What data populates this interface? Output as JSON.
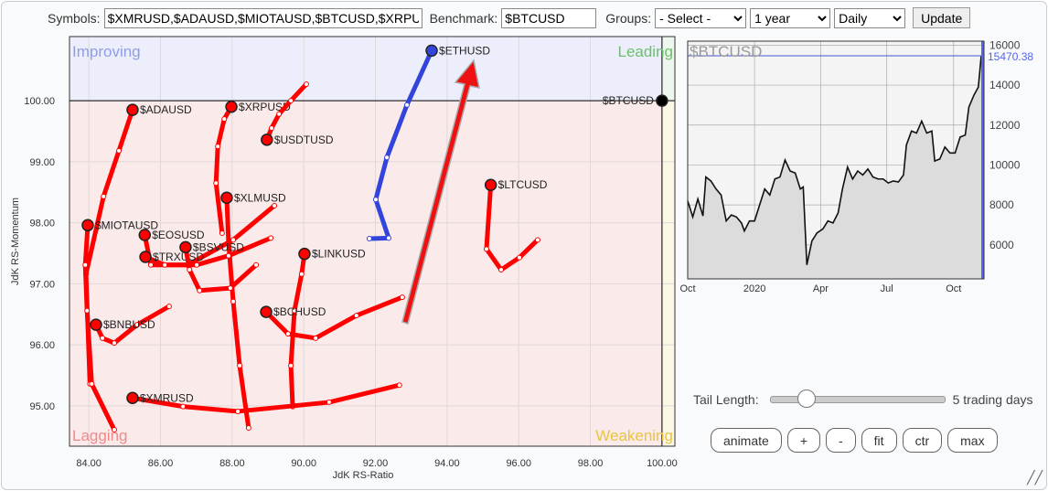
{
  "toolbar": {
    "symbols_label": "Symbols:",
    "symbols_value": "$XMRUSD,$ADAUSD,$MIOTAUSD,$BTCUSD,$XRPUSD",
    "benchmark_label": "Benchmark:",
    "benchmark_value": "$BTCUSD",
    "groups_label": "Groups:",
    "groups_value": "- Select -",
    "period_value": "1 year",
    "frequency_value": "Daily",
    "update_label": "Update"
  },
  "controls": {
    "tail_label": "Tail Length:",
    "tail_value_text": "5 trading days",
    "tail_fraction": 0.17,
    "buttons": [
      "animate",
      "+",
      "-",
      "fit",
      "ctr",
      "max"
    ]
  },
  "chart_data": [
    {
      "type": "scatter",
      "xlabel": "JdK RS-Ratio",
      "ylabel": "JdK RS-Momentum",
      "xlim": [
        83.46,
        100.36
      ],
      "ylim": [
        94.34,
        101.05
      ],
      "xticks": [
        "84.00",
        "86.00",
        "88.00",
        "90.00",
        "92.00",
        "94.00",
        "96.00",
        "98.00",
        "100.00"
      ],
      "yticks": [
        "95.00",
        "96.00",
        "97.00",
        "98.00",
        "99.00",
        "100.00"
      ],
      "grid": true,
      "quadrants": {
        "improving": "Improving",
        "leading": "Leading",
        "lagging": "Lagging",
        "weakening": "Weakening"
      },
      "colors": {
        "improving": "#8f9de8",
        "leading": "#6cbf6c",
        "lagging": "#f08a8a",
        "weakening": "#e8c440",
        "tail_red": "#ff0000",
        "tail_blue": "#3344dd",
        "benchmark": "#000000"
      },
      "series": [
        {
          "name": "$ETHUSD",
          "color": "#3344dd",
          "tail": [
            [
              91.83,
              97.74
            ],
            [
              92.37,
              97.75
            ],
            [
              92.01,
              98.38
            ],
            [
              92.32,
              99.07
            ],
            [
              92.88,
              99.93
            ],
            [
              93.57,
              100.82
            ]
          ]
        },
        {
          "name": "$ADAUSD",
          "color": "#ff0000",
          "tail": [
            [
              84.03,
              95.36
            ],
            [
              83.92,
              97.16
            ],
            [
              84.41,
              98.43
            ],
            [
              84.84,
              99.18
            ],
            [
              85.22,
              99.85
            ]
          ]
        },
        {
          "name": "$XRPUSD",
          "color": "#ff0000",
          "tail": [
            [
              87.72,
              97.83
            ],
            [
              87.55,
              98.65
            ],
            [
              87.6,
              99.25
            ],
            [
              87.78,
              99.7
            ],
            [
              87.98,
              99.9
            ]
          ]
        },
        {
          "name": "$USDTUSD",
          "color": "#ff0000",
          "tail": [
            [
              90.07,
              100.27
            ],
            [
              89.64,
              100.0
            ],
            [
              89.31,
              99.78
            ],
            [
              89.1,
              99.55
            ],
            [
              88.97,
              99.36
            ]
          ]
        },
        {
          "name": "$XLMUSD",
          "color": "#ff0000",
          "tail": [
            [
              88.46,
              94.64
            ],
            [
              88.21,
              95.66
            ],
            [
              88.03,
              96.71
            ],
            [
              87.9,
              97.68
            ],
            [
              87.85,
              98.41
            ]
          ]
        },
        {
          "name": "$MIOTAUSD",
          "color": "#ff0000",
          "tail": [
            [
              84.71,
              94.61
            ],
            [
              84.08,
              95.36
            ],
            [
              83.95,
              96.56
            ],
            [
              83.9,
              97.31
            ],
            [
              83.97,
              97.96
            ]
          ]
        },
        {
          "name": "$EOSUSD",
          "color": "#ff0000",
          "tail": [
            [
              89.18,
              98.28
            ],
            [
              88.03,
              97.72
            ],
            [
              86.76,
              97.31
            ],
            [
              85.73,
              97.31
            ],
            [
              85.56,
              97.8
            ]
          ]
        },
        {
          "name": "$TRXUSD",
          "color": "#ff0000",
          "tail": [
            [
              89.08,
              97.75
            ],
            [
              87.9,
              97.46
            ],
            [
              87.01,
              97.31
            ],
            [
              86.12,
              97.31
            ],
            [
              85.58,
              97.44
            ]
          ]
        },
        {
          "name": "$BSVUSD",
          "color": "#ff0000",
          "tail": [
            [
              88.67,
              97.31
            ],
            [
              87.95,
              96.93
            ],
            [
              87.09,
              96.89
            ],
            [
              86.81,
              97.23
            ],
            [
              86.7,
              97.6
            ]
          ]
        },
        {
          "name": "$LINKUSD",
          "color": "#ff0000",
          "tail": [
            [
              89.69,
              94.99
            ],
            [
              89.64,
              95.66
            ],
            [
              89.74,
              96.56
            ],
            [
              89.94,
              97.16
            ],
            [
              90.02,
              97.49
            ]
          ]
        },
        {
          "name": "$LTCUSD",
          "color": "#ff0000",
          "tail": [
            [
              96.53,
              97.72
            ],
            [
              96.02,
              97.43
            ],
            [
              95.51,
              97.23
            ],
            [
              95.1,
              97.57
            ],
            [
              95.22,
              98.62
            ]
          ]
        },
        {
          "name": "$BCHUSD",
          "color": "#ff0000",
          "tail": [
            [
              92.75,
              96.78
            ],
            [
              91.47,
              96.48
            ],
            [
              90.33,
              96.11
            ],
            [
              89.56,
              96.18
            ],
            [
              88.95,
              96.54
            ]
          ]
        },
        {
          "name": "$BNBUSD",
          "color": "#ff0000",
          "tail": [
            [
              86.24,
              96.63
            ],
            [
              85.35,
              96.33
            ],
            [
              84.71,
              96.03
            ],
            [
              84.38,
              96.11
            ],
            [
              84.2,
              96.33
            ]
          ]
        },
        {
          "name": "$XMRUSD",
          "color": "#ff0000",
          "tail": [
            [
              92.67,
              95.34
            ],
            [
              90.71,
              95.06
            ],
            [
              88.16,
              94.91
            ],
            [
              86.63,
              94.99
            ],
            [
              85.22,
              95.13
            ]
          ]
        },
        {
          "name": "$BTCUSD",
          "color": "#000000",
          "tail": [
            [
              100.0,
              100.0
            ]
          ]
        }
      ]
    },
    {
      "type": "area",
      "title": "$BTCUSD",
      "last_value": "15470.38",
      "ylim": [
        4300,
        16200
      ],
      "yticks": [
        "6000",
        "8000",
        "10000",
        "12000",
        "14000",
        "16000"
      ],
      "xticks": [
        {
          "label": "Oct",
          "date": "2019-10-01"
        },
        {
          "label": "2020",
          "date": "2020-01-01"
        },
        {
          "label": "Apr",
          "date": "2020-04-01"
        },
        {
          "label": "Jul",
          "date": "2020-07-01"
        },
        {
          "label": "Oct",
          "date": "2020-10-01"
        }
      ],
      "grid": true,
      "x": [
        "2019-10-01",
        "2019-10-08",
        "2019-10-15",
        "2019-10-22",
        "2019-10-26",
        "2019-11-02",
        "2019-11-09",
        "2019-11-16",
        "2019-11-23",
        "2019-11-30",
        "2019-12-07",
        "2019-12-14",
        "2019-12-18",
        "2019-12-25",
        "2020-01-01",
        "2020-01-08",
        "2020-01-15",
        "2020-01-22",
        "2020-01-29",
        "2020-02-05",
        "2020-02-12",
        "2020-02-19",
        "2020-02-26",
        "2020-03-04",
        "2020-03-08",
        "2020-03-13",
        "2020-03-20",
        "2020-03-27",
        "2020-04-04",
        "2020-04-11",
        "2020-04-18",
        "2020-04-25",
        "2020-05-01",
        "2020-05-08",
        "2020-05-15",
        "2020-05-22",
        "2020-05-29",
        "2020-06-05",
        "2020-06-12",
        "2020-06-19",
        "2020-06-26",
        "2020-07-03",
        "2020-07-10",
        "2020-07-17",
        "2020-07-24",
        "2020-07-28",
        "2020-08-04",
        "2020-08-11",
        "2020-08-18",
        "2020-08-25",
        "2020-09-01",
        "2020-09-05",
        "2020-09-12",
        "2020-09-19",
        "2020-09-26",
        "2020-10-03",
        "2020-10-10",
        "2020-10-17",
        "2020-10-22",
        "2020-10-29",
        "2020-11-04",
        "2020-11-08"
      ],
      "y": [
        8200,
        7400,
        8300,
        7450,
        9400,
        9200,
        8800,
        8500,
        7200,
        7500,
        7400,
        7100,
        6700,
        7200,
        7200,
        8000,
        8800,
        8500,
        9300,
        9400,
        10250,
        9700,
        9600,
        8800,
        8900,
        5000,
        6200,
        6600,
        6800,
        7200,
        7100,
        7600,
        8800,
        9900,
        9300,
        9700,
        9500,
        9800,
        9400,
        9300,
        9300,
        9100,
        9200,
        9150,
        9500,
        11000,
        11700,
        11600,
        12200,
        11600,
        11700,
        10200,
        10300,
        10900,
        10600,
        10600,
        11400,
        11500,
        12900,
        13500,
        13900,
        15470
      ]
    }
  ]
}
